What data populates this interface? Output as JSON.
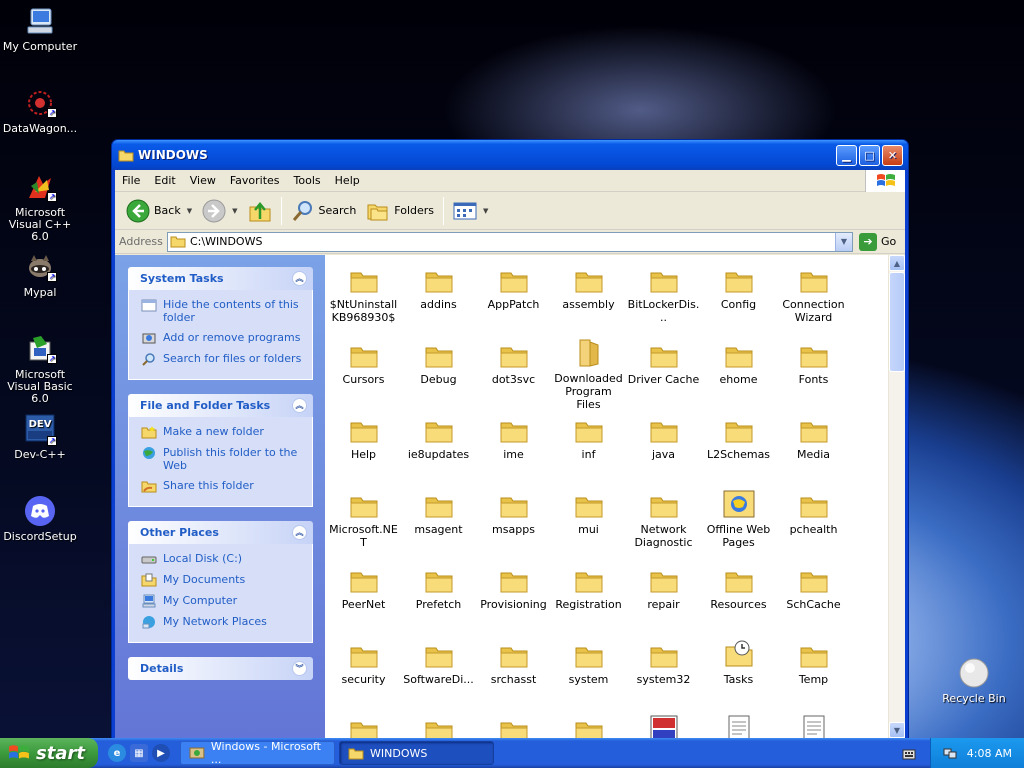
{
  "desktop": {
    "icons": [
      {
        "label": "My Computer"
      },
      {
        "label": "DataWagon..."
      },
      {
        "label": "Microsoft Visual C++ 6.0"
      },
      {
        "label": "Mypal"
      },
      {
        "label": "Microsoft Visual Basic 6.0"
      },
      {
        "label": "Dev-C++"
      },
      {
        "label": "DiscordSetup"
      },
      {
        "label": "Recycle Bin"
      }
    ]
  },
  "window": {
    "title": "WINDOWS",
    "menu": [
      "File",
      "Edit",
      "View",
      "Favorites",
      "Tools",
      "Help"
    ],
    "toolbar": {
      "back": "Back",
      "search": "Search",
      "folders": "Folders"
    },
    "address": {
      "label": "Address",
      "value": "C:\\WINDOWS",
      "go": "Go"
    },
    "left_pane": {
      "system_tasks": {
        "title": "System Tasks",
        "items": [
          "Hide the contents of this folder",
          "Add or remove programs",
          "Search for files or folders"
        ]
      },
      "file_folder_tasks": {
        "title": "File and Folder Tasks",
        "items": [
          "Make a new folder",
          "Publish this folder to the Web",
          "Share this folder"
        ]
      },
      "other_places": {
        "title": "Other Places",
        "items": [
          "Local Disk (C:)",
          "My Documents",
          "My Computer",
          "My Network Places"
        ]
      },
      "details": {
        "title": "Details"
      }
    },
    "files": [
      "$NtUninstallKB968930$",
      "addins",
      "AppPatch",
      "assembly",
      "BitLockerDis...",
      "Config",
      "Connection Wizard",
      "Cursors",
      "Debug",
      "dot3svc",
      "Downloaded Program Files",
      "Driver Cache",
      "ehome",
      "Fonts",
      "Help",
      "ie8updates",
      "ime",
      "inf",
      "java",
      "L2Schemas",
      "Media",
      "Microsoft.NET",
      "msagent",
      "msapps",
      "mui",
      "Network Diagnostic",
      "Offline Web Pages",
      "pchealth",
      "PeerNet",
      "Prefetch",
      "Provisioning",
      "Registration",
      "repair",
      "Resources",
      "SchCache",
      "security",
      "SoftwareDi...",
      "srchasst",
      "system",
      "system32",
      "Tasks",
      "Temp"
    ]
  },
  "taskbar": {
    "start": "start",
    "buttons": [
      {
        "label": "Windows - Microsoft ..."
      },
      {
        "label": "WINDOWS"
      }
    ],
    "clock": "4:08 AM"
  }
}
